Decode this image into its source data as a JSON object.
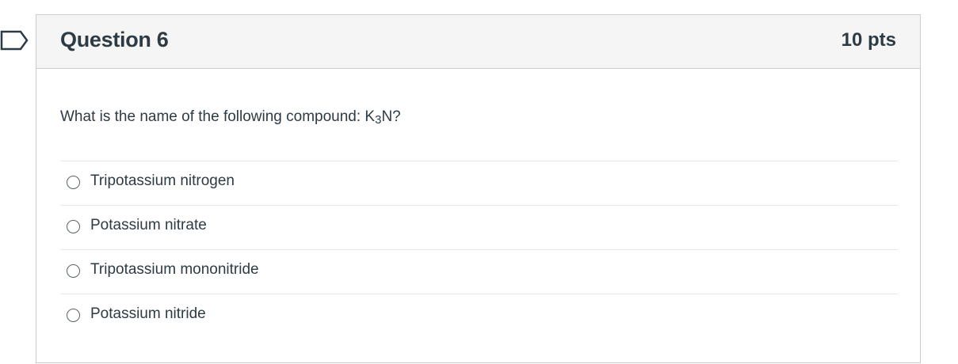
{
  "question": {
    "title": "Question 6",
    "points": "10 pts",
    "text_prefix": "What is the name of the following compound: K",
    "text_subscript": "3",
    "text_suffix": "N?",
    "flag_icon": "bookmark-flag-icon"
  },
  "answers": [
    {
      "label": "Tripotassium nitrogen",
      "selected": false
    },
    {
      "label": "Potassium nitrate",
      "selected": false
    },
    {
      "label": "Tripotassium mononitride",
      "selected": false
    },
    {
      "label": "Potassium nitride",
      "selected": false
    }
  ]
}
